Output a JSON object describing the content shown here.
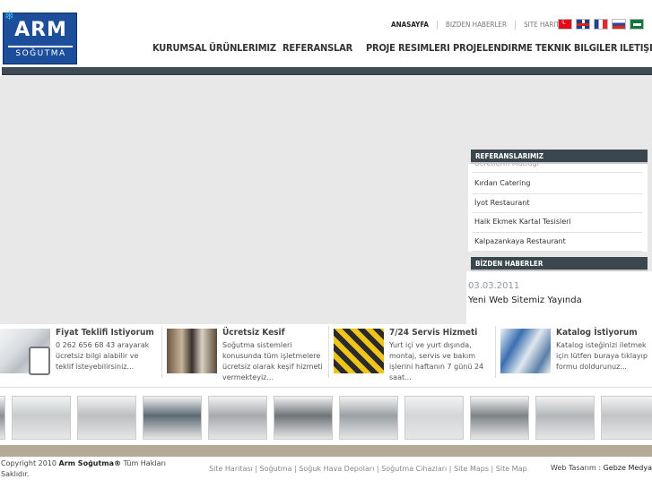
{
  "logo": {
    "brand": "ARM",
    "sub": "SOĞUTMA"
  },
  "toplinks": [
    "ANASAYFA",
    "BIZDEN HABERLER",
    "SITE HARITASI"
  ],
  "flags": [
    "tr",
    "gb",
    "fr",
    "ru",
    "sa"
  ],
  "nav": [
    "KURUMSAL",
    "ÜRÜNLERIMIZ",
    "REFERANSLAR",
    "PROJE RESIMLERI",
    "PROJELENDIRME",
    "TEKNIK BILGILER",
    "ILETIŞIM"
  ],
  "references": {
    "heading": "REFERANSLARIMIZ",
    "items": [
      "Kırdan Catering",
      "İyot Restaurant",
      "Halk Ekmek Kartal Tesisleri",
      "Kalpazankaya Restaurant"
    ]
  },
  "news": {
    "heading": "BİZDEN HABERLER",
    "date": "03.03.2011",
    "title": "Yeni Web Sitemiz Yayında"
  },
  "promos": [
    {
      "title": "Fiyat Teklifi Istiyorum",
      "text": "0 262 656 68 43 arayarak ücretsiz bilgi alabilir ve teklif isteyebilirsiniz..."
    },
    {
      "title": "Ücretsiz Kesif",
      "text": "Soğutma sistemleri konusunda tüm işletmelere ücretsiz olarak keşif hizmeti vermekteyiz..."
    },
    {
      "title": "7/24 Servis Hizmeti",
      "text": "Yurt içi ve yurt dışında, montaj, servis ve bakım işlerini haftanın 7 günü 24 saat..."
    },
    {
      "title": "Katalog İstiyorum",
      "text": "Katalog isteğinizi iletmek için lütfen buraya tıklayıp formu doldurunuz..."
    }
  ],
  "gallery_count": 11,
  "footer": {
    "copy_pre": "Copyright 2010",
    "copy_brand": "Arm Soğutma®",
    "copy_post": "Tüm Hakları",
    "copy2": "Saklıdır.",
    "links": "Site Haritası | Soğutma | Soğuk Hava Depoları | Soğutma Cihazları | Site Maps | Site Map",
    "webdesign_pre": "Web Tasarım :",
    "webdesign_brand": "Gebze Medya"
  }
}
